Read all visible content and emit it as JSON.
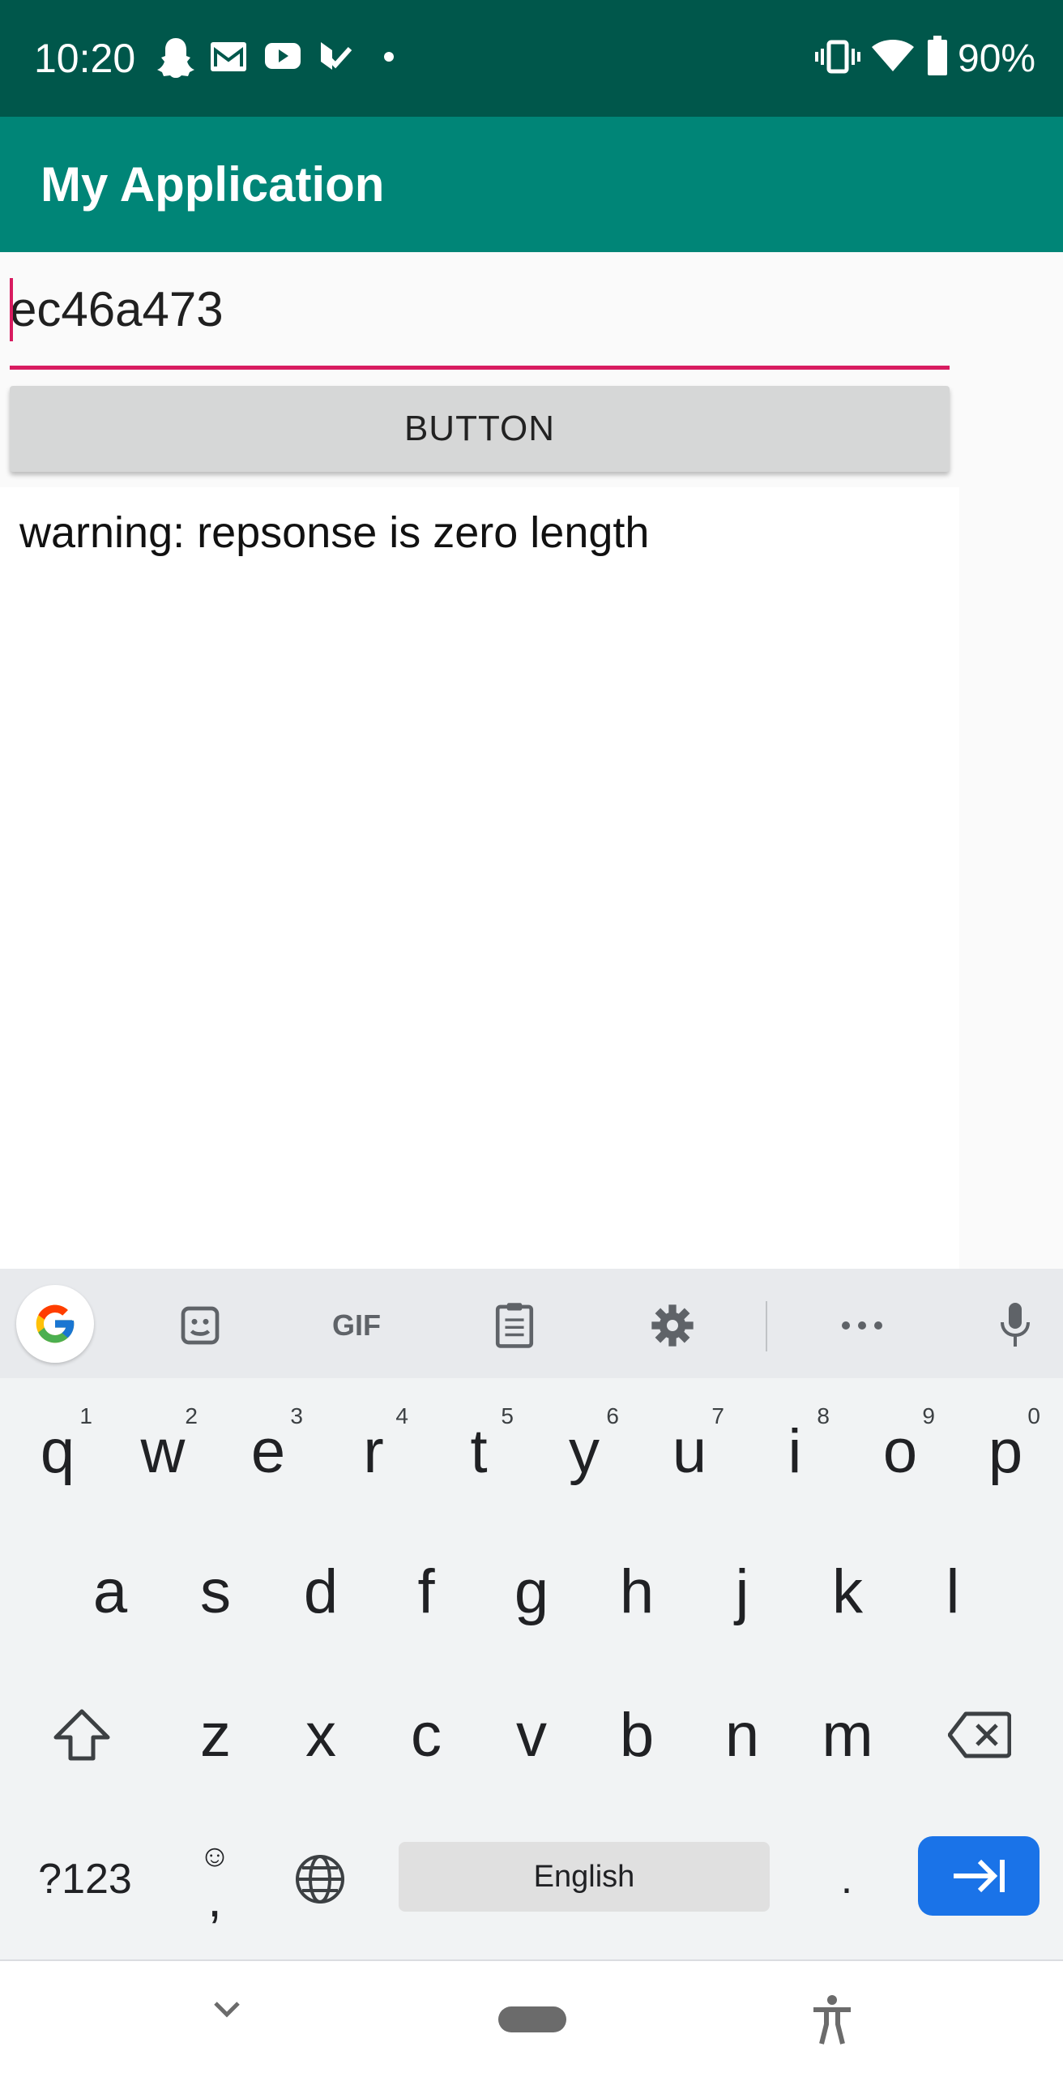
{
  "status_bar": {
    "time": "10:20",
    "battery_percent": "90%",
    "notification_icons": [
      "snapchat-icon",
      "gmail-icon",
      "youtube-icon",
      "tasks-icon",
      "dot-icon"
    ],
    "system_icons": [
      "vibrate-icon",
      "wifi-icon",
      "battery-icon"
    ]
  },
  "app_bar": {
    "title": "My Application"
  },
  "main": {
    "edit_text": {
      "value": "ec46a473"
    },
    "button_label": "BUTTON",
    "output_text": "warning: repsonse is zero length"
  },
  "keyboard": {
    "toolbar": [
      "google-icon",
      "sticker-icon",
      "GIF",
      "clipboard-icon",
      "gear-icon",
      "more-icon",
      "microphone-icon"
    ],
    "row1": [
      {
        "key": "q",
        "hint": "1"
      },
      {
        "key": "w",
        "hint": "2"
      },
      {
        "key": "e",
        "hint": "3"
      },
      {
        "key": "r",
        "hint": "4"
      },
      {
        "key": "t",
        "hint": "5"
      },
      {
        "key": "y",
        "hint": "6"
      },
      {
        "key": "u",
        "hint": "7"
      },
      {
        "key": "i",
        "hint": "8"
      },
      {
        "key": "o",
        "hint": "9"
      },
      {
        "key": "p",
        "hint": "0"
      }
    ],
    "row2": [
      "a",
      "s",
      "d",
      "f",
      "g",
      "h",
      "j",
      "k",
      "l"
    ],
    "row3": [
      "z",
      "x",
      "c",
      "v",
      "b",
      "n",
      "m"
    ],
    "symbols_key": "?123",
    "comma_key": ",",
    "space_label": "English",
    "period_key": ".",
    "colors": {
      "enter": "#1a73e8"
    }
  },
  "nav_bar": {
    "icons": [
      "chevron-down-icon",
      "home-pill-icon",
      "accessibility-icon"
    ]
  },
  "colors": {
    "status_bar": "#00574b",
    "app_bar": "#008577",
    "accent": "#d81b60"
  }
}
